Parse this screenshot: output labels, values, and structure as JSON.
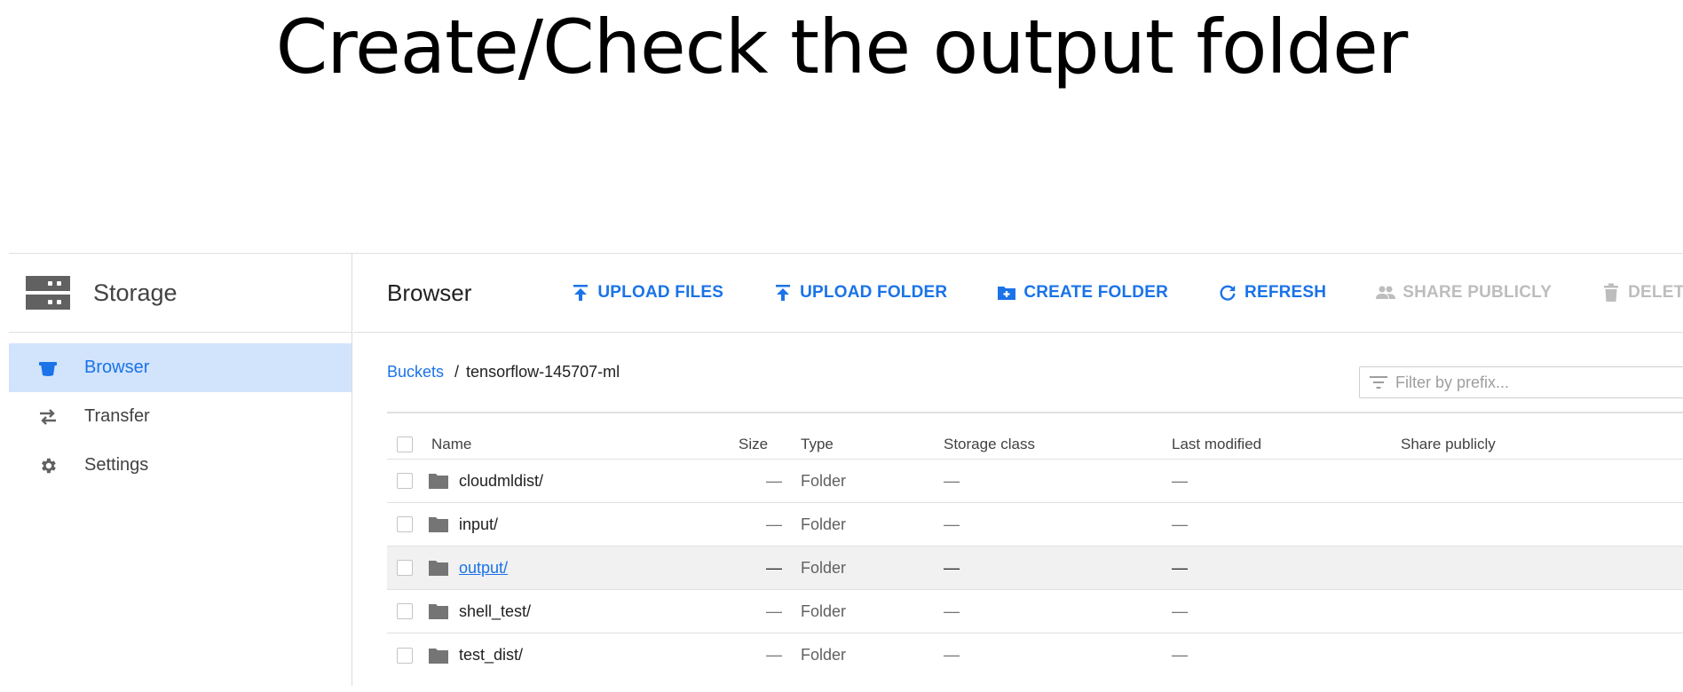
{
  "slide": {
    "title": "Create/Check the output folder"
  },
  "sidebar": {
    "title": "Storage",
    "items": [
      {
        "label": "Browser",
        "icon": "bucket-icon",
        "active": true
      },
      {
        "label": "Transfer",
        "icon": "transfer-icon",
        "active": false
      },
      {
        "label": "Settings",
        "icon": "gear-icon",
        "active": false
      }
    ]
  },
  "toolbar": {
    "title": "Browser",
    "upload_files": "UPLOAD FILES",
    "upload_folder": "UPLOAD FOLDER",
    "create_folder": "CREATE FOLDER",
    "refresh": "REFRESH",
    "share_publicly": "SHARE PUBLICLY",
    "delete": "DELETE"
  },
  "breadcrumb": {
    "root": "Buckets",
    "separator": "/",
    "current": "tensorflow-145707-ml"
  },
  "filter": {
    "placeholder": "Filter by prefix..."
  },
  "table": {
    "columns": {
      "name": "Name",
      "size": "Size",
      "type": "Type",
      "storage_class": "Storage class",
      "last_modified": "Last modified",
      "share_publicly": "Share publicly"
    },
    "rows": [
      {
        "name": "cloudmldist/",
        "size": "—",
        "type": "Folder",
        "storage_class": "—",
        "last_modified": "—"
      },
      {
        "name": "input/",
        "size": "—",
        "type": "Folder",
        "storage_class": "—",
        "last_modified": "—"
      },
      {
        "name": "output/",
        "size": "—",
        "type": "Folder",
        "storage_class": "—",
        "last_modified": "—"
      },
      {
        "name": "shell_test/",
        "size": "—",
        "type": "Folder",
        "storage_class": "—",
        "last_modified": "—"
      },
      {
        "name": "test_dist/",
        "size": "—",
        "type": "Folder",
        "storage_class": "—",
        "last_modified": "—"
      }
    ]
  },
  "colors": {
    "accent": "#1a73e8",
    "active_bg": "#d2e3fc",
    "disabled": "#bdbdbd",
    "highlight_row": "#f1f1f1"
  }
}
